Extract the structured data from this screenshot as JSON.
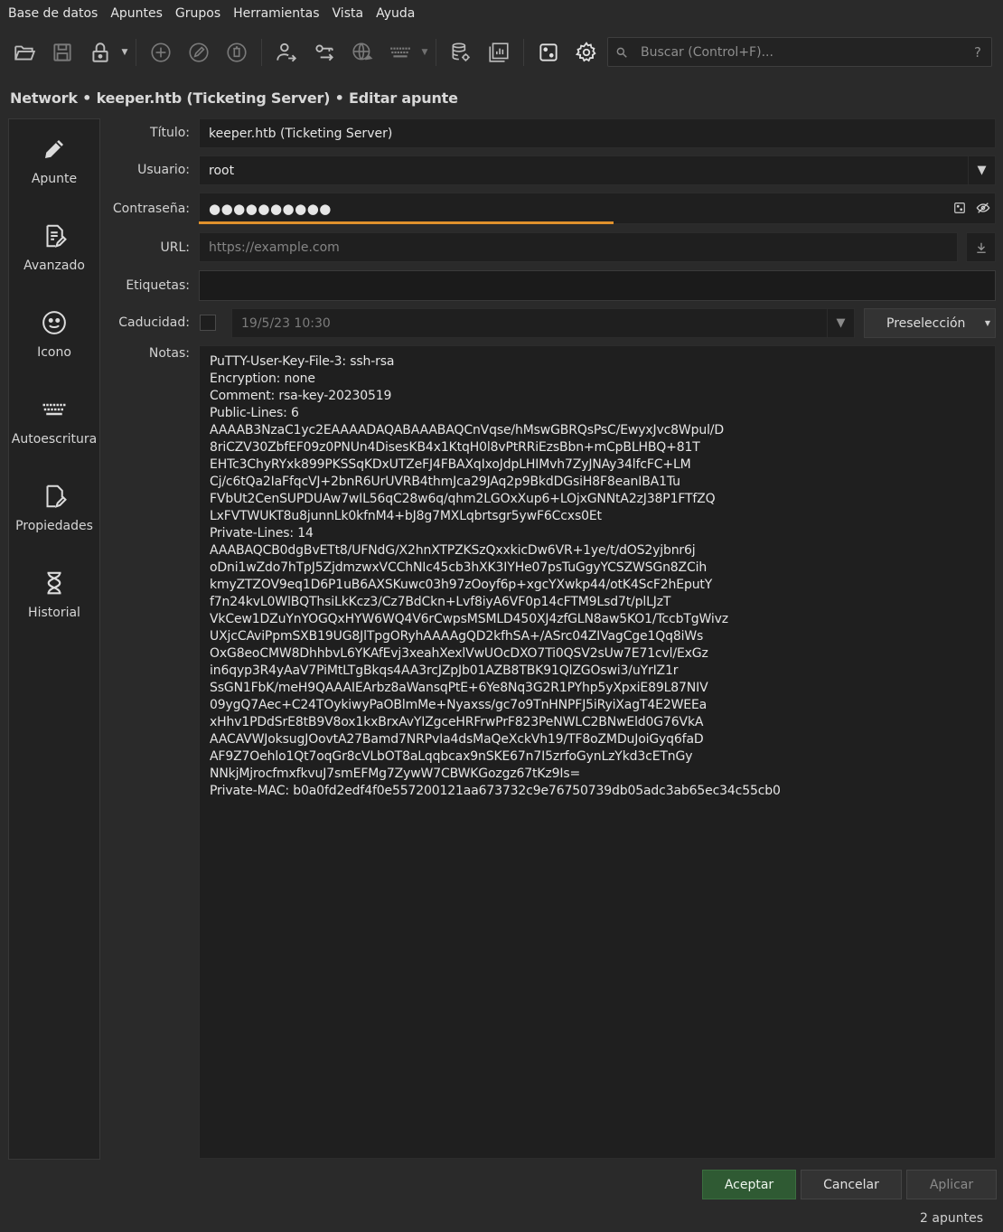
{
  "menubar": {
    "items": [
      "Base de datos",
      "Apuntes",
      "Grupos",
      "Herramientas",
      "Vista",
      "Ayuda"
    ]
  },
  "toolbar": {
    "buttons": [
      {
        "name": "open-database",
        "icon": "folder-open-icon"
      },
      {
        "name": "save-database",
        "icon": "save-icon"
      },
      {
        "name": "lock-database",
        "icon": "lock-icon"
      },
      {
        "name": "add-entry",
        "icon": "plus-circle-icon"
      },
      {
        "name": "edit-entry",
        "icon": "pencil-circle-icon"
      },
      {
        "name": "delete-entry",
        "icon": "trash-circle-icon"
      },
      {
        "name": "copy-username",
        "icon": "user-arrow-icon"
      },
      {
        "name": "copy-password",
        "icon": "key-arrow-icon"
      },
      {
        "name": "open-url",
        "icon": "globe-icon"
      },
      {
        "name": "autotype",
        "icon": "keyboard-icon"
      },
      {
        "name": "database-settings",
        "icon": "database-gear-icon"
      },
      {
        "name": "reports",
        "icon": "chart-icon"
      },
      {
        "name": "password-generator",
        "icon": "dice-icon"
      },
      {
        "name": "settings",
        "icon": "gear-icon"
      }
    ]
  },
  "search": {
    "placeholder": "Buscar (Control+F)...",
    "help": "?"
  },
  "breadcrumb": "Network • keeper.htb (Ticketing Server) • Editar apunte",
  "sidebar": {
    "items": [
      {
        "label": "Apunte",
        "icon": "pencil-icon"
      },
      {
        "label": "Avanzado",
        "icon": "document-edit-icon"
      },
      {
        "label": "Icono",
        "icon": "smiley-icon"
      },
      {
        "label": "Autoescritura",
        "icon": "keyboard-icon"
      },
      {
        "label": "Propiedades",
        "icon": "document-edit-icon"
      },
      {
        "label": "Historial",
        "icon": "hourglass-icon"
      }
    ]
  },
  "form": {
    "title_label": "Título:",
    "title_value": "keeper.htb (Ticketing Server)",
    "username_label": "Usuario:",
    "username_value": "root",
    "password_label": "Contraseña:",
    "password_value": "●●●●●●●●●●",
    "password_strength": 0.52,
    "url_label": "URL:",
    "url_placeholder": "https://example.com",
    "tags_label": "Etiquetas:",
    "tags_value": "",
    "expiry_label": "Caducidad:",
    "expiry_checked": false,
    "expiry_value": "19/5/23 10:30",
    "preset_label": "Preselección",
    "notes_label": "Notas:",
    "notes": "PuTTY-User-Key-File-3: ssh-rsa\nEncryption: none\nComment: rsa-key-20230519\nPublic-Lines: 6\nAAAAB3NzaC1yc2EAAAADAQABAAABAQCnVqse/hMswGBRQsPsC/EwyxJvc8Wpul/D\n8riCZV30ZbfEF09z0PNUn4DisesKB4x1KtqH0l8vPtRRiEzsBbn+mCpBLHBQ+81T\nEHTc3ChyRYxk899PKSSqKDxUTZeFJ4FBAXqIxoJdpLHIMvh7ZyJNAy34lfcFC+LM\nCj/c6tQa2IaFfqcVJ+2bnR6UrUVRB4thmJca29JAq2p9BkdDGsiH8F8eanIBA1Tu\nFVbUt2CenSUPDUAw7wIL56qC28w6q/qhm2LGOxXup6+LOjxGNNtA2zJ38P1FTfZQ\nLxFVTWUKT8u8junnLk0kfnM4+bJ8g7MXLqbrtsgr5ywF6Ccxs0Et\nPrivate-Lines: 14\nAAABAQCB0dgBvETt8/UFNdG/X2hnXTPZKSzQxxkicDw6VR+1ye/t/dOS2yjbnr6j\noDni1wZdo7hTpJ5ZjdmzwxVCChNIc45cb3hXK3IYHe07psTuGgyYCSZWSGn8ZCih\nkmyZTZOV9eq1D6P1uB6AXSKuwc03h97zOoyf6p+xgcYXwkp44/otK4ScF2hEputY\nf7n24kvL0WlBQThsiLkKcz3/Cz7BdCkn+Lvf8iyA6VF0p14cFTM9Lsd7t/plLJzT\nVkCew1DZuYnYOGQxHYW6WQ4V6rCwpsMSMLD450XJ4zfGLN8aw5KO1/TccbTgWivz\nUXjcCAviPpmSXB19UG8JlTpgORyhAAAAgQD2kfhSA+/ASrc04ZIVagCge1Qq8iWs\nOxG8eoCMW8DhhbvL6YKAfEvj3xeahXexlVwUOcDXO7Ti0QSV2sUw7E71cvl/ExGz\nin6qyp3R4yAaV7PiMtLTgBkqs4AA3rcJZpJb01AZB8TBK91QlZGOswi3/uYrIZ1r\nSsGN1FbK/meH9QAAAIEArbz8aWansqPtE+6Ye8Nq3G2R1PYhp5yXpxiE89L87NIV\n09ygQ7Aec+C24TOykiwyPaOBlmMe+Nyaxss/gc7o9TnHNPFJ5iRyiXagT4E2WEEa\nxHhv1PDdSrE8tB9V8ox1kxBrxAvYIZgceHRFrwPrF823PeNWLC2BNwEld0G76VkA\nAACAVWJoksugJOovtA27Bamd7NRPvIa4dsMaQeXckVh19/TF8oZMDuJoiGyq6faD\nAF9Z7Oehlo1Qt7oqGr8cVLbOT8aLqqbcax9nSKE67n7I5zrfoGynLzYkd3cETnGy\nNNkjMjrocfmxfkvuJ7smEFMg7ZywW7CBWKGozgz67tKz9Is=\nPrivate-MAC: b0a0fd2edf4f0e557200121aa673732c9e76750739db05adc3ab65ec34c55cb0"
  },
  "buttons": {
    "accept": "Aceptar",
    "cancel": "Cancelar",
    "apply": "Aplicar"
  },
  "status": "2 apuntes",
  "colors": {
    "accent_strength": "#e0912c",
    "primary_button": "#2f5a33",
    "background": "#2a2a2a"
  }
}
